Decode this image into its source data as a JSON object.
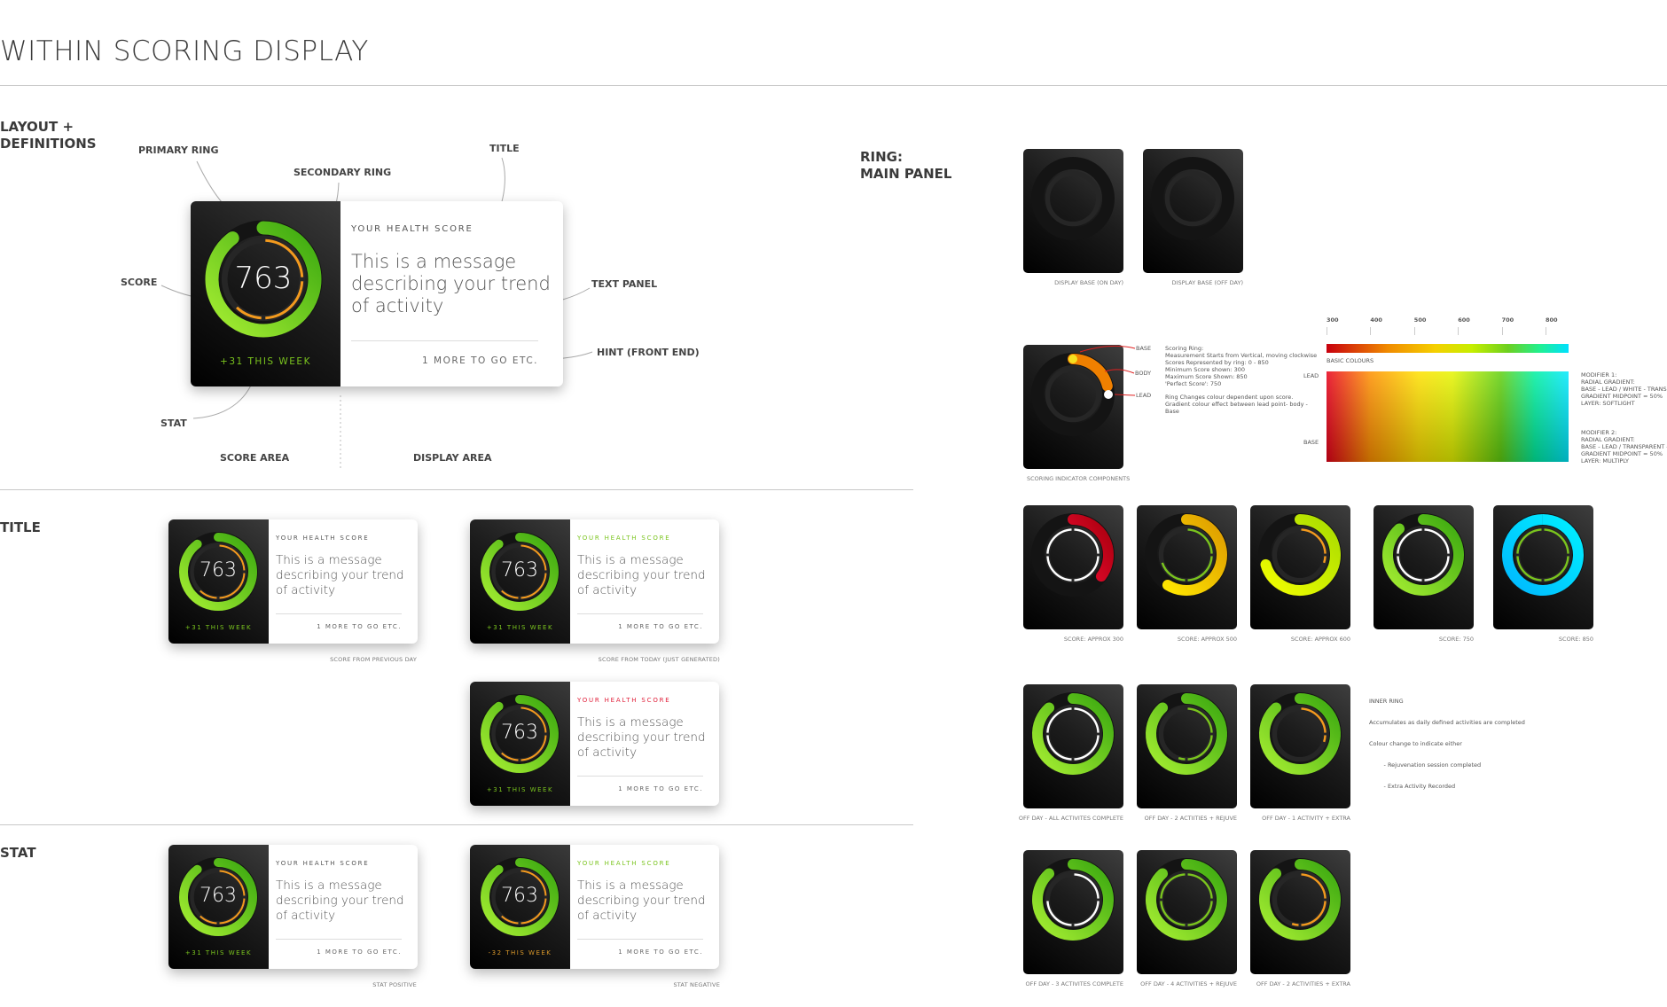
{
  "page_title": "WITHIN SCORING DISPLAY",
  "layout_section": {
    "heading": "LAYOUT +\nDEFINITIONS",
    "labels": {
      "primary_ring": "PRIMARY RING",
      "secondary_ring": "SECONDARY RING",
      "title": "TITLE",
      "score": "SCORE",
      "text_panel": "TEXT PANEL",
      "hint": "HINT (FRONT END)",
      "stat": "STAT",
      "score_area": "SCORE AREA",
      "display_area": "DISPLAY AREA"
    }
  },
  "cards": [
    {
      "size": "lg",
      "title": "YOUR HEALTH SCORE",
      "title_color": "#555555",
      "score": "763",
      "ring_score": 763,
      "inner": "#f39a1e",
      "inner_fraction": 0.62,
      "message": "This is a message describing your trend of activity",
      "hint": "1 MORE TO GO ETC.",
      "stat": "+31 THIS WEEK",
      "stat_color": "#7ac41e"
    },
    {
      "size": "sm",
      "title": "YOUR HEALTH SCORE",
      "title_color": "#555555",
      "score": "763",
      "ring_score": 763,
      "inner": "#f39a1e",
      "inner_fraction": 0.62,
      "message": "This is a message describing your trend of activity",
      "hint": "1 MORE TO GO ETC.",
      "stat": "+31 THIS WEEK",
      "stat_color": "#7ac41e",
      "caption": "SCORE FROM PREVIOUS DAY"
    },
    {
      "size": "sm",
      "title": "YOUR HEALTH SCORE",
      "title_color": "#7ac41e",
      "score": "763",
      "ring_score": 763,
      "inner": "#f39a1e",
      "inner_fraction": 0.62,
      "message": "This is a message describing your trend of activity",
      "hint": "1 MORE TO GO ETC.",
      "stat": "+31 THIS WEEK",
      "stat_color": "#7ac41e",
      "caption": "SCORE FROM TODAY (JUST GENERATED)"
    },
    {
      "size": "sm",
      "title": "YOUR HEALTH SCORE",
      "title_color": "#e0203a",
      "score": "763",
      "ring_score": 763,
      "inner": "#f39a1e",
      "inner_fraction": 0.62,
      "message": "This is a message describing your trend of activity",
      "hint": "1 MORE TO GO ETC.",
      "stat": "+31 THIS WEEK",
      "stat_color": "#7ac41e",
      "caption": ""
    },
    {
      "size": "sm",
      "title": "YOUR HEALTH SCORE",
      "title_color": "#555555",
      "score": "763",
      "ring_score": 763,
      "inner": "#f39a1e",
      "inner_fraction": 0.62,
      "message": "This is a message describing your trend of activity",
      "hint": "1 MORE TO GO ETC.",
      "stat": "+31 THIS WEEK",
      "stat_color": "#7ac41e",
      "caption": "STAT POSITIVE"
    },
    {
      "size": "sm",
      "title": "YOUR HEALTH SCORE",
      "title_color": "#7ac41e",
      "score": "763",
      "ring_score": 763,
      "inner": "#f39a1e",
      "inner_fraction": 0.62,
      "message": "This is a message describing your trend of activity",
      "hint": "1 MORE TO GO ETC.",
      "stat": "-32 THIS WEEK",
      "stat_color": "#d9982a",
      "caption": "STAT NEGATIVE"
    }
  ],
  "title_section": {
    "heading": "TITLE"
  },
  "stat_section": {
    "heading": "STAT"
  },
  "ring_section": {
    "heading": "RING:\nMAIN PANEL",
    "base_panels": [
      {
        "caption": "DISPLAY BASE (ON DAY)"
      },
      {
        "caption": "DISPLAY BASE (OFF DAY)"
      }
    ],
    "indicator": {
      "caption": "SCORING INDICATOR COMPONENTS",
      "parts": [
        "BASE",
        "BODY",
        "LEAD"
      ],
      "notes1": [
        "Scoring Ring:",
        "Measurement Starts from Vertical, moving clockwise",
        "Scores Represented by ring: 0 - 850",
        "Minimum Score shown: 300",
        "Maximum Score Shown: 850",
        "'Perfect Score': 750"
      ],
      "notes2": [
        "Ring Changes colour dependent upon score.",
        "Gradient colour effect between lead point- body -",
        "Base"
      ]
    },
    "scale": {
      "ticks": [
        "300",
        "400",
        "500",
        "600",
        "700",
        "800"
      ],
      "basic_label": "BASIC COLOURS",
      "lead_label": "LEAD",
      "base_label": "BASE",
      "modifier1": [
        "MODIFIER 1:",
        "RADIAL GRADIENT:",
        "BASE - LEAD / WHITE - TRANSPARENT",
        "GRADIENT MIDPOINT = 50%",
        "LAYER: SOFTLIGHT"
      ],
      "modifier2": [
        "MODIFIER 2:",
        "RADIAL GRADIENT:",
        "BASE - LEAD / TRANSPARENT - BLACK",
        "GRADIENT MIDPOINT = 50%",
        "LAYER: MULTIPLY"
      ]
    },
    "score_panels": [
      {
        "caption": "SCORE: APPROX 300",
        "score": 300,
        "c1": "#a8000e",
        "c2": "#ee0a30",
        "inner": "#ffffff",
        "inner_fraction": 1
      },
      {
        "caption": "SCORE: APPROX 500",
        "score": 500,
        "c1": "#dd9a00",
        "c2": "#ffe600",
        "inner": "#7ac41e",
        "inner_fraction": 0.7
      },
      {
        "caption": "SCORE: APPROX 600",
        "score": 600,
        "c1": "#a8dc00",
        "c2": "#f2ff00",
        "inner": "#f39a1e",
        "inner_fraction": 0.3
      },
      {
        "caption": "SCORE: 750",
        "score": 750,
        "c1": "#3aa810",
        "c2": "#a6ee32",
        "inner": "#ffffff",
        "inner_fraction": 1
      },
      {
        "caption": "SCORE: 850",
        "score": 850,
        "c1": "#00f0ff",
        "c2": "#00b8ff",
        "inner": "#7ac41e",
        "inner_fraction": 1
      }
    ],
    "inner_note": [
      "INNER RING",
      "Accumulates as daily defined activities are completed",
      "Colour change to indicate either",
      "        - Rejuvenation session completed",
      "        - Extra Activity Recorded"
    ],
    "offday_panels": [
      {
        "caption": "OFF DAY - ALL ACTIVITES COMPLETE",
        "score": 750,
        "inner": "#ffffff",
        "inner_fraction": 1
      },
      {
        "caption": "OFF DAY - 2 ACTIITIES + REJUVE",
        "score": 750,
        "inner": "#7ac41e",
        "inner_fraction": 0.55
      },
      {
        "caption": "OFF DAY - 1 ACTIVITY + EXTRA",
        "score": 750,
        "inner": "#f39a1e",
        "inner_fraction": 0.3
      },
      {
        "caption": "OFF DAY - 3 ACTIVITES COMPLETE",
        "score": 750,
        "inner": "#ffffff",
        "inner_fraction": 0.75
      },
      {
        "caption": "OFF DAY - 4 ACTIVITIES + REJUVE",
        "score": 750,
        "inner": "#7ac41e",
        "inner_fraction": 1
      },
      {
        "caption": "OFF DAY - 2 ACTIVITIES + EXTRA",
        "score": 750,
        "inner": "#f39a1e",
        "inner_fraction": 0.55
      }
    ]
  },
  "colors": {
    "green": "#7ac41e",
    "orange": "#f39a1e",
    "red": "#e0203a",
    "ring_green_dark": "#3aa810",
    "ring_green_light": "#a6ee32"
  }
}
